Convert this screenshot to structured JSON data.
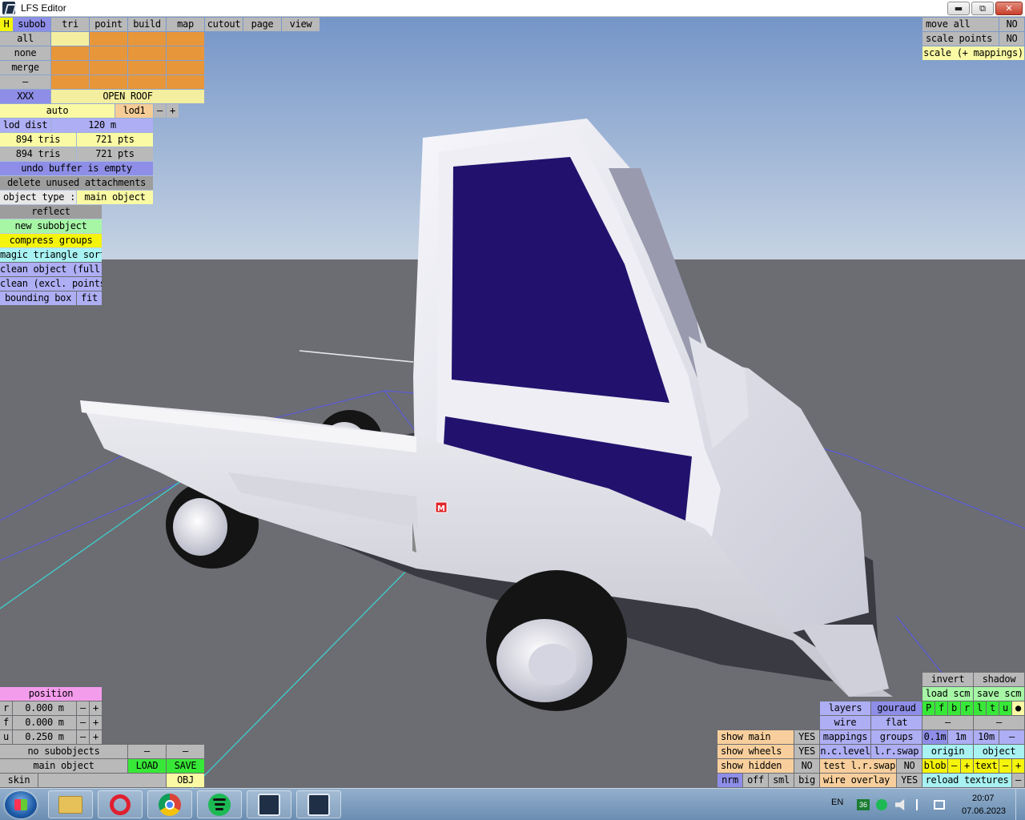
{
  "window": {
    "title": "LFS Editor",
    "minimize": "▬",
    "restore": "⧉",
    "close": "✕"
  },
  "menu": {
    "H": "H",
    "tabs": [
      "subob",
      "tri",
      "point",
      "build",
      "map",
      "cutout",
      "page",
      "view"
    ]
  },
  "subobj": {
    "all": "all",
    "none": "none",
    "merge": "merge",
    "dash": "–",
    "name_btn": "XXX",
    "name": "OPEN ROOF"
  },
  "lod": {
    "auto": "auto",
    "lod1": "lod1",
    "minus": "–",
    "plus": "+",
    "dist_label": "lod dist",
    "dist_value": "120 m"
  },
  "stats": {
    "tris1": "894 tris",
    "pts1": "721 pts",
    "tris2": "894 tris",
    "pts2": "721 pts"
  },
  "undo": "undo buffer is empty",
  "delete_unused": "delete unused attachments",
  "object_type": {
    "label": "object type :",
    "value": "main object"
  },
  "actions": {
    "reflect": "reflect",
    "new_subobject": "new subobject",
    "compress_groups": "compress groups",
    "magic_sort": "magic triangle sort",
    "clean_full": "clean object (full)",
    "clean_excl": "clean (excl. points)",
    "bounding_box": "bounding box",
    "fit": "fit"
  },
  "top_right": {
    "move_all": "move all",
    "move_all_val": "NO",
    "scale_points": "scale points",
    "scale_points_val": "NO",
    "scale_mappings": "scale (+ mappings)"
  },
  "position": {
    "header": "position",
    "rows": [
      {
        "axis": "r",
        "value": "0.000 m"
      },
      {
        "axis": "f",
        "value": "0.000 m"
      },
      {
        "axis": "u",
        "value": "0.250 m"
      }
    ],
    "minus": "–",
    "plus": "+"
  },
  "bottom_left": {
    "no_subobjects": "no subobjects",
    "dash": "–",
    "main_object": "main object",
    "load": "LOAD",
    "save": "SAVE",
    "skin": "skin",
    "obj": "OBJ"
  },
  "view_panel": {
    "show_main": "show main",
    "show_main_val": "YES",
    "show_wheels": "show wheels",
    "show_wheels_val": "YES",
    "show_hidden": "show hidden",
    "show_hidden_val": "NO",
    "nrm": "nrm",
    "off": "off",
    "sml": "sml",
    "big": "big",
    "layers": "layers",
    "gouraud": "gouraud",
    "wire": "wire",
    "flat": "flat",
    "mappings": "mappings",
    "groups": "groups",
    "nc_level": "n.c.level",
    "lr_swap": "l.r.swap",
    "test_lr_swap": "test l.r.swap",
    "test_lr_swap_val": "NO",
    "wire_overlay": "wire overlay",
    "wire_overlay_val": "YES",
    "invert": "invert",
    "shadow": "shadow",
    "load_scm": "load scm",
    "save_scm": "save scm",
    "letters": [
      "P",
      "f",
      "b",
      "r",
      "l",
      "t",
      "u",
      "●"
    ],
    "dash": "–",
    "grid": [
      "0.1m",
      "1m",
      "10m"
    ],
    "minus": "–",
    "origin": "origin",
    "object": "object",
    "blob": "blob",
    "text": "text",
    "plus": "+",
    "reload_textures": "reload textures"
  },
  "viewport": {
    "marker": "M"
  },
  "taskbar": {
    "lang": "EN",
    "badge": "36",
    "time": "20:07",
    "date": "07.06.2023"
  },
  "icons": [
    "windows-start-icon",
    "file-explorer-icon",
    "opera-icon",
    "chrome-icon",
    "spotify-icon",
    "lfs-icon",
    "lfs-editor-icon"
  ]
}
